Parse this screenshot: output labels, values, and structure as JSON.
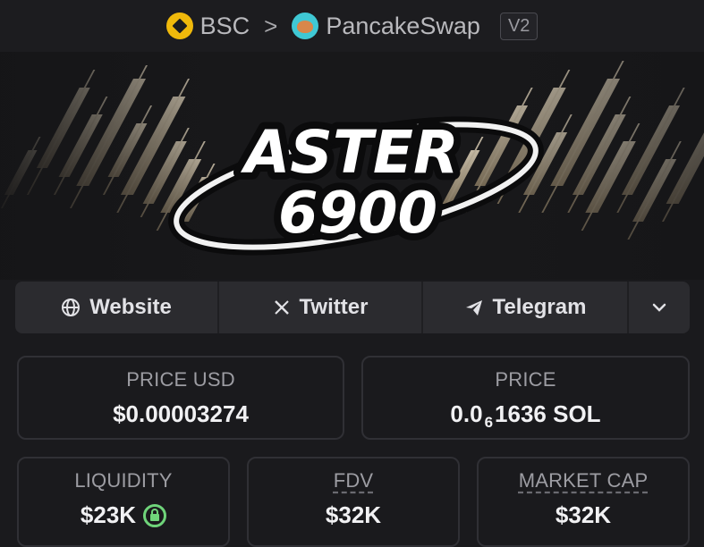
{
  "header": {
    "chain": "BSC",
    "separator": ">",
    "dex": "PancakeSwap",
    "version": "V2",
    "chain_icon": "bsc-coin-icon",
    "dex_icon": "pancakeswap-bunny-icon"
  },
  "banner": {
    "logo_line1": "ASTER",
    "logo_line2": "6900"
  },
  "links": {
    "website": "Website",
    "twitter": "Twitter",
    "telegram": "Telegram",
    "more_icon": "chevron-down-icon"
  },
  "stats": {
    "price_usd": {
      "label": "PRICE USD",
      "value": "$0.00003274"
    },
    "price_native": {
      "label": "PRICE",
      "prefix": "0.0",
      "zeros": "6",
      "rest": "1636 SOL"
    },
    "liquidity": {
      "label": "LIQUIDITY",
      "value": "$23K"
    },
    "fdv": {
      "label": "FDV",
      "value": "$32K"
    },
    "market_cap": {
      "label": "MARKET CAP",
      "value": "$32K"
    }
  },
  "colors": {
    "background": "#1a1a1d",
    "panel": "#2b2b2f",
    "bsc_yellow": "#f0b90b",
    "lock_green": "#6fd47a"
  }
}
